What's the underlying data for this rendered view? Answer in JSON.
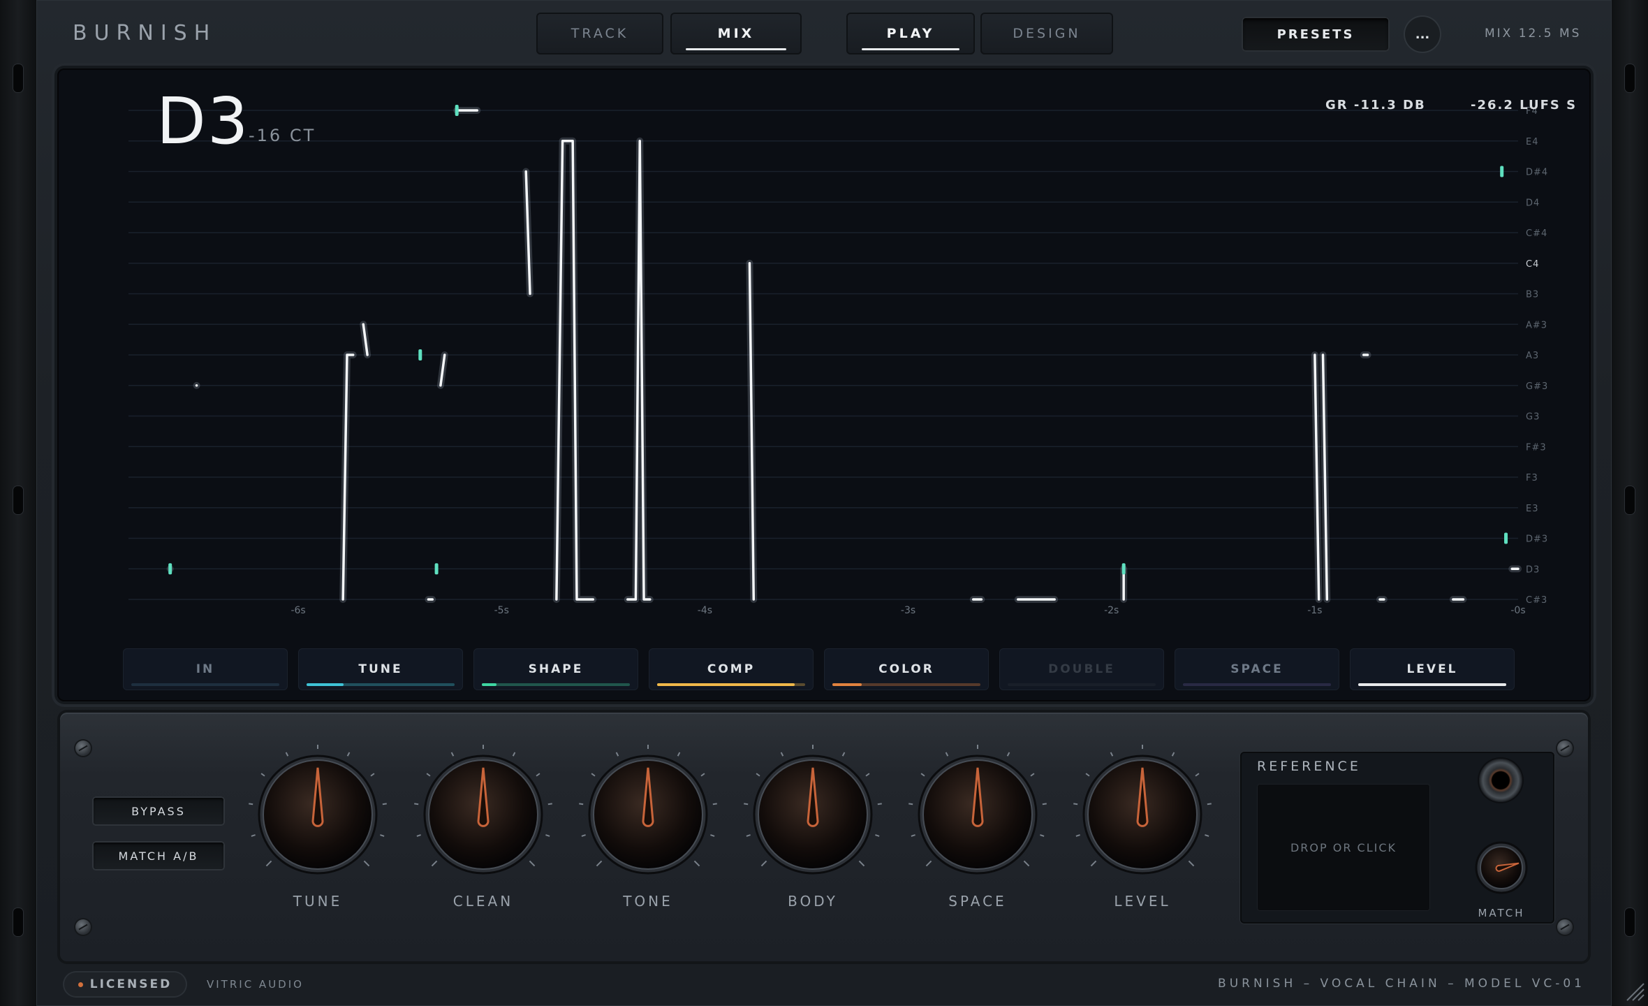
{
  "app": {
    "name": "BURNISH"
  },
  "nav": {
    "tabs": [
      {
        "label": "TRACK",
        "active": false
      },
      {
        "label": "MIX",
        "active": true
      }
    ],
    "modes": [
      {
        "label": "PLAY",
        "active": true
      },
      {
        "label": "DESIGN",
        "active": false
      }
    ],
    "presets_label": "PRESETS",
    "more_label": "...",
    "mix_readout": "MIX  12.5 MS"
  },
  "display": {
    "note": "D3",
    "cents": "-16 CT",
    "gr": "GR -11.3 DB",
    "lufs": "-26.2 LUFS S",
    "pitch_labels": [
      "C#3",
      "D3",
      "D#3",
      "E3",
      "F3",
      "F#3",
      "G3",
      "G#3",
      "A3",
      "A#3",
      "B3",
      "C4",
      "C#4",
      "D4",
      "D#4",
      "E4",
      "F4"
    ],
    "time_labels": [
      "-6s",
      "-5s",
      "-4s",
      "-3s",
      "-2s",
      "-1s",
      "-0s"
    ]
  },
  "pitch_trace": {
    "segments": [
      [
        [
          -6.63,
          "D3"
        ],
        [
          -6.63,
          "D3"
        ]
      ],
      [
        [
          -6.5,
          "G#3"
        ],
        [
          -6.5,
          "G#3"
        ]
      ],
      [
        [
          -5.78,
          "C#3"
        ],
        [
          -5.76,
          "A3"
        ],
        [
          -5.75,
          "A3"
        ],
        [
          -5.73,
          "A3"
        ]
      ],
      [
        [
          -5.68,
          "A#3"
        ],
        [
          -5.66,
          "A3"
        ]
      ],
      [
        [
          -5.28,
          "A3"
        ],
        [
          -5.3,
          "G#3"
        ]
      ],
      [
        [
          -5.36,
          "C#3"
        ],
        [
          -5.34,
          "C#3"
        ]
      ],
      [
        [
          -5.22,
          "F4"
        ],
        [
          -5.12,
          "F4"
        ]
      ],
      [
        [
          -4.88,
          "D#4"
        ],
        [
          -4.86,
          "B3"
        ]
      ],
      [
        [
          -4.73,
          "C#3"
        ],
        [
          -4.7,
          "E4"
        ],
        [
          -4.65,
          "E4"
        ],
        [
          -4.63,
          "C#3"
        ],
        [
          -4.55,
          "C#3"
        ]
      ],
      [
        [
          -4.38,
          "C#3"
        ],
        [
          -4.34,
          "C#3"
        ],
        [
          -4.32,
          "E4"
        ],
        [
          -4.3,
          "C#3"
        ],
        [
          -4.27,
          "C#3"
        ]
      ],
      [
        [
          -3.78,
          "C4"
        ],
        [
          -3.76,
          "C#3"
        ]
      ],
      [
        [
          -2.68,
          "C#3"
        ],
        [
          -2.64,
          "C#3"
        ]
      ],
      [
        [
          -2.46,
          "C#3"
        ],
        [
          -2.28,
          "C#3"
        ]
      ],
      [
        [
          -1.94,
          "C#3"
        ],
        [
          -1.94,
          "D3"
        ]
      ],
      [
        [
          -1.0,
          "A3"
        ],
        [
          -0.98,
          "C#3"
        ]
      ],
      [
        [
          -0.96,
          "A3"
        ],
        [
          -0.94,
          "C#3"
        ]
      ],
      [
        [
          -0.76,
          "A3"
        ],
        [
          -0.74,
          "A3"
        ]
      ],
      [
        [
          -0.68,
          "C#3"
        ],
        [
          -0.66,
          "C#3"
        ]
      ],
      [
        [
          -0.32,
          "C#3"
        ],
        [
          -0.27,
          "C#3"
        ]
      ],
      [
        [
          -0.03,
          "D3"
        ],
        [
          0.0,
          "D3"
        ]
      ]
    ],
    "markers": [
      [
        -6.63,
        "D3"
      ],
      [
        -5.4,
        "A3"
      ],
      [
        -5.32,
        "D3"
      ],
      [
        -5.22,
        "F4"
      ],
      [
        -1.94,
        "D3"
      ],
      [
        -0.08,
        "D#4"
      ],
      [
        -0.06,
        "D#3"
      ]
    ]
  },
  "stages": [
    {
      "label": "IN",
      "level": 0.0,
      "color": "#3a5f7a",
      "active": false
    },
    {
      "label": "TUNE",
      "level": 0.25,
      "color": "#3fc3d6",
      "active": true
    },
    {
      "label": "SHAPE",
      "level": 0.1,
      "color": "#3fd6a2",
      "active": true
    },
    {
      "label": "COMP",
      "level": 0.93,
      "color": "#f0b84a",
      "active": true
    },
    {
      "label": "COLOR",
      "level": 0.2,
      "color": "#e0823f",
      "active": true
    },
    {
      "label": "DOUBLE",
      "level": 0.0,
      "color": "#2a303a",
      "active": false
    },
    {
      "label": "SPACE",
      "level": 0.0,
      "color": "#5a4e8a",
      "active": false
    },
    {
      "label": "LEVEL",
      "level": 1.0,
      "color": "#e8eaec",
      "active": true
    }
  ],
  "panel": {
    "bypass_label": "BYPASS",
    "match_ab_label": "MATCH A/B",
    "knobs": [
      {
        "label": "TUNE",
        "value": 0.5
      },
      {
        "label": "CLEAN",
        "value": 0.5
      },
      {
        "label": "TONE",
        "value": 0.5
      },
      {
        "label": "BODY",
        "value": 0.5
      },
      {
        "label": "SPACE",
        "value": 0.5
      },
      {
        "label": "LEVEL",
        "value": 0.5
      }
    ],
    "reference": {
      "title": "REFERENCE",
      "drop_label": "DROP OR CLICK",
      "match_label": "MATCH",
      "match_value": 0.78
    }
  },
  "footer": {
    "license_label": "LICENSED",
    "vendor": "VITRIC AUDIO",
    "model": "BURNISH  –  VOCAL CHAIN  –  MODEL VC-01"
  },
  "colors": {
    "accent": "#c8643a",
    "trace": "#f4f6f8",
    "marker": "#5fe0c0",
    "license_dot": "#d2703c"
  }
}
